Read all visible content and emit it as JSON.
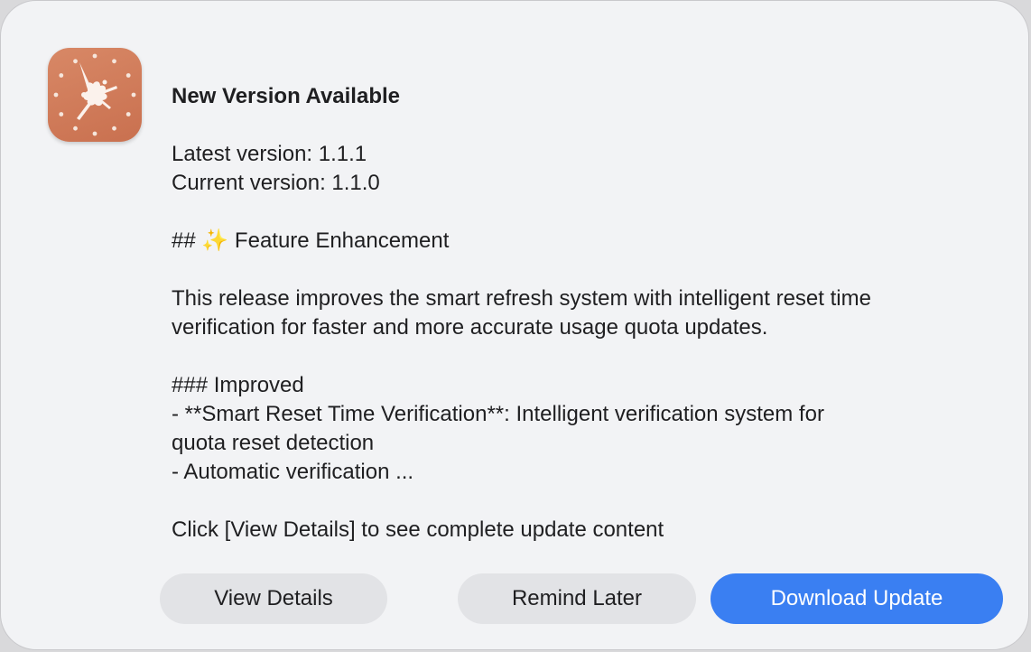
{
  "dialog": {
    "app_icon": "claude-burst-clock-icon",
    "title": "New Version Available",
    "latest_version": "Latest version: 1.1.1",
    "current_version": "Current version: 1.1.0",
    "feature_heading_prefix": "## ",
    "feature_heading_emoji": "✨",
    "feature_heading_text": " Feature Enhancement",
    "description_line1": "This release improves the smart refresh system with intelligent reset time",
    "description_line2": "verification for faster and more accurate usage quota updates.",
    "improved_heading": "### Improved",
    "bullet1_line1": "- **Smart Reset Time Verification**: Intelligent verification system for",
    "bullet1_line2": "quota reset detection",
    "bullet2": "- Automatic verification ...",
    "footer_hint": "Click [View Details] to see complete update content"
  },
  "buttons": {
    "view_details": "View Details",
    "remind_later": "Remind Later",
    "download_update": "Download Update"
  },
  "colors": {
    "icon_background": "#cf7755",
    "primary_button": "#3a7ff2",
    "secondary_button": "#e2e3e6",
    "dialog_background": "#f2f3f5"
  }
}
